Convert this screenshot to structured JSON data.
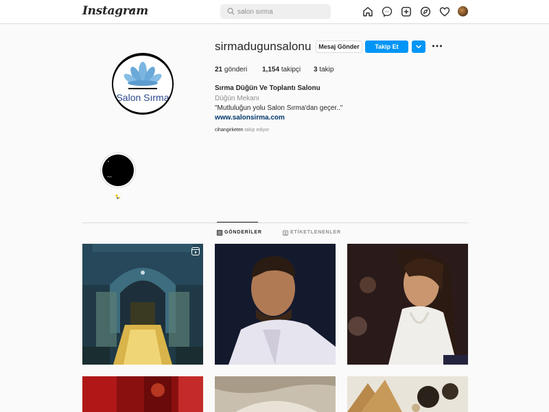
{
  "nav": {
    "logo": "Instagram",
    "search_value": "salon sırma",
    "icons": [
      "home-icon",
      "messenger-icon",
      "new-post-icon",
      "explore-icon",
      "activity-heart-icon",
      "profile-avatar"
    ]
  },
  "profile": {
    "username": "sirmadugunsalonu",
    "avatar_text": "Salon Sırma",
    "message_button": "Mesaj Gönder",
    "follow_button": "Takip Et",
    "stats": {
      "posts_count": "21",
      "posts_label": "gönderi",
      "followers_count": "1,154",
      "followers_label": "takipçi",
      "following_count": "3",
      "following_label": "takip"
    },
    "full_name": "Sırma Düğün Ve Toplantı Salonu",
    "category": "Düğün Mekanı",
    "bio": "\"Mutluluğun yolu Salon Sırma'dan geçer..\"",
    "website": "www.salonsirma.com",
    "followed_by_user": "cihangirketen",
    "followed_by_text": "takip ediyor"
  },
  "tabs": {
    "posts": "GÖNDERİLER",
    "tagged": "ETİKETLENENLER"
  },
  "colors": {
    "accent_blue": "#0095f6",
    "link_blue": "#00376b",
    "logo_lotus": "#7ab6e0"
  }
}
